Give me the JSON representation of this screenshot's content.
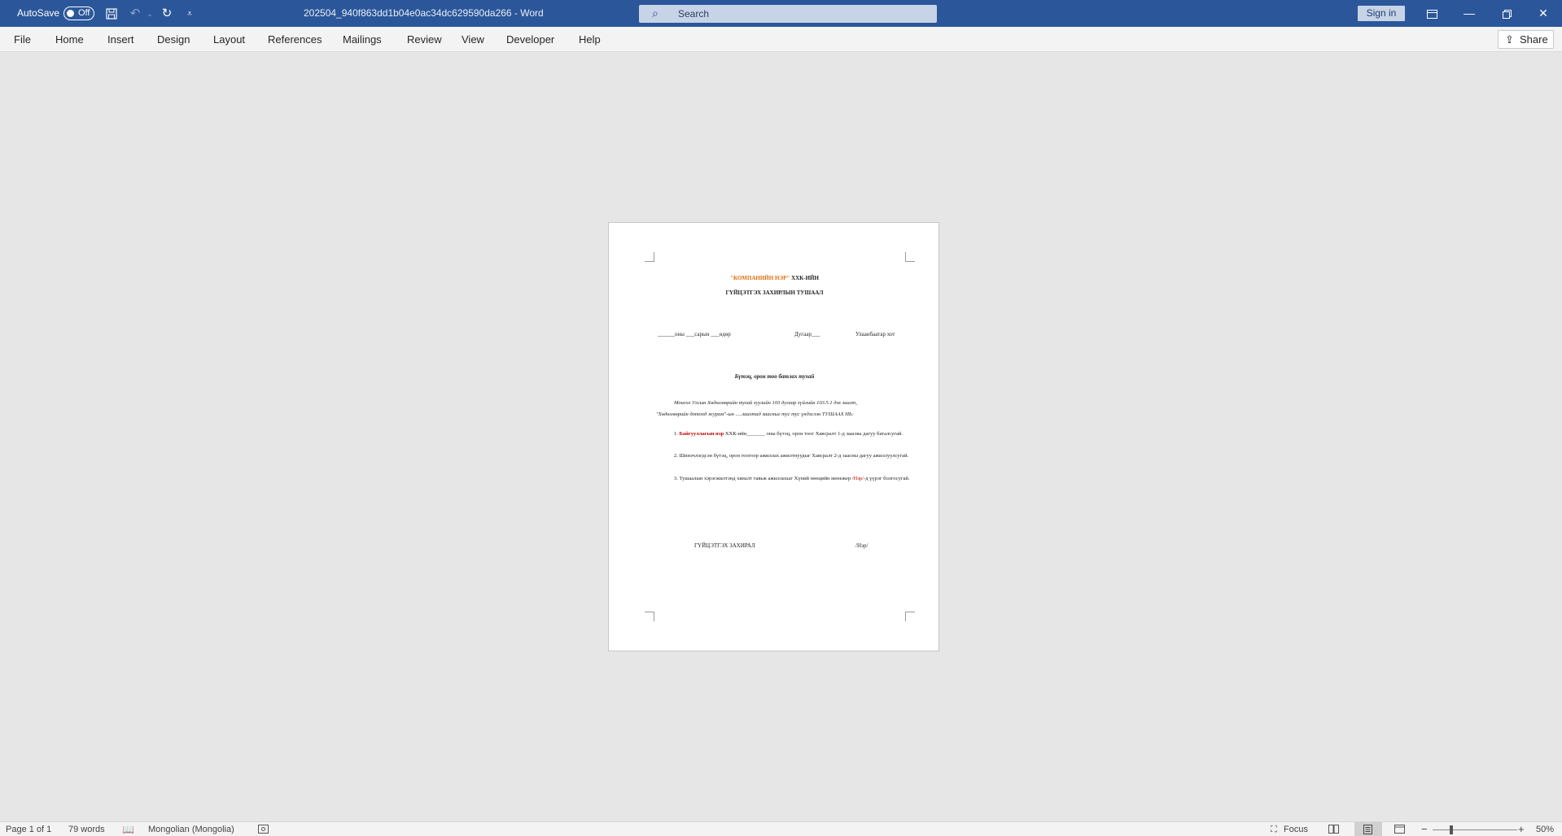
{
  "titlebar": {
    "autosave_label": "AutoSave",
    "autosave_state": "Off",
    "doc_title": "202504_940f863dd1b04e0ac34dc629590da266  -  Word",
    "search_placeholder": "Search",
    "signin_label": "Sign in",
    "icons": {
      "save": "save-icon",
      "undo": "undo-icon",
      "redo": "redo-icon",
      "customize": "customize-qat-icon",
      "ribbon_display": "ribbon-display-icon",
      "minimize": "minimize-icon",
      "restore": "restore-icon",
      "close": "close-icon"
    }
  },
  "ribbon": {
    "tabs": [
      "File",
      "Home",
      "Insert",
      "Design",
      "Layout",
      "References",
      "Mailings",
      "Review",
      "View",
      "Developer",
      "Help"
    ],
    "share_label": "Share"
  },
  "document": {
    "title_line1_orange": "\"КОМПАНИЙН НЭР\"",
    "title_line1_rest": " ХХК-ИЙН",
    "title_line2": "ГҮЙЦЭТГЭХ ЗАХИРЛЫН ТУШААЛ",
    "date_line": "______оны ___сарын ___өдөр",
    "number_line": "Дугаар___",
    "city_line": "Улаанбаатар хот",
    "subject": "Бүтэц, орон тоо батлах тухай",
    "preamble_1": "Монгол Улсын Хөдөлмөрийн тухай хуулийн 103 дугаар зүйлийн 103.5.1 дэх заалт,",
    "preamble_2": "\"Хөдөлмөрийн дотоод журам\"-ын .....заалтад заасныг тус тус үндэслэн ТУШААХ НЬ:",
    "item1_num": "1.",
    "item1_red": "Байгууллагын нэр",
    "item1_rest": " ХХК-ийн_______ оны бүтэц, орон тоог Хавсралт 1-д заасны дагуу баталсугай.",
    "item2": "2.   Шинэчлэгдсэн бүтэц, орон тоогоор ажиллах ажилтнуудыг Хавсралт 2-д заасны дагуу ажиллуулсугай.",
    "item3_start": "3.   Тушаалын хэрэгжилтэнд хяналт тавьж ажиллахыг Хүний нөөцийн менежер ",
    "item3_red": "/Нэр/",
    "item3_end": "-д үүрэг болгосугай.",
    "sign_title": "ГҮЙЦЭТГЭХ ЗАХИРАЛ",
    "sign_name": "/Нэр/"
  },
  "statusbar": {
    "page": "Page 1 of 1",
    "words": "79 words",
    "language": "Mongolian (Mongolia)",
    "focus": "Focus",
    "zoom": "50%"
  }
}
